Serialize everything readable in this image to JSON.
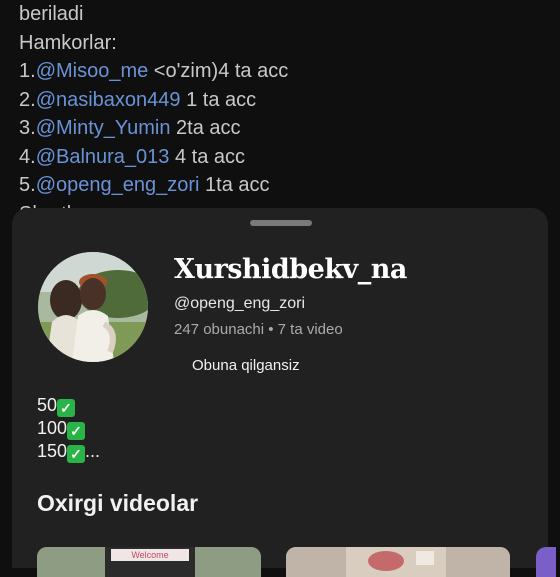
{
  "background_post": {
    "line1": "beriladi",
    "line2": "Hamkorlar:",
    "partners": [
      {
        "num": "1.",
        "mention": "@Misoo_me",
        "suffix": " <o'zim)4 ta acc"
      },
      {
        "num": "2.",
        "mention": "@nasibaxon449",
        "suffix": " 1 ta acc"
      },
      {
        "num": "3.",
        "mention": "@Minty_Yumin",
        "suffix": " 2ta acc"
      },
      {
        "num": "4.",
        "mention": "@Balnura_013",
        "suffix": "  4 ta acc"
      },
      {
        "num": "5.",
        "mention": "@openg_eng_zori",
        "suffix": " 1ta acc"
      }
    ],
    "cut_line": "Shartla..."
  },
  "channel": {
    "name": "Xurshidbekv_na",
    "handle": "@openg_eng_zori",
    "stats": "247 obunachi • 7 ta video",
    "subscribe_label": "Obuna qilgansiz",
    "description": {
      "l1": "50",
      "l2": "100",
      "l3": "150",
      "l3_suffix": "..."
    }
  },
  "recent": {
    "title": "Oxirgi videolar",
    "thumb1_caption": "Welcome"
  },
  "colors": {
    "mention": "#6a93d6",
    "sheet": "#212121",
    "check": "#28b446"
  }
}
